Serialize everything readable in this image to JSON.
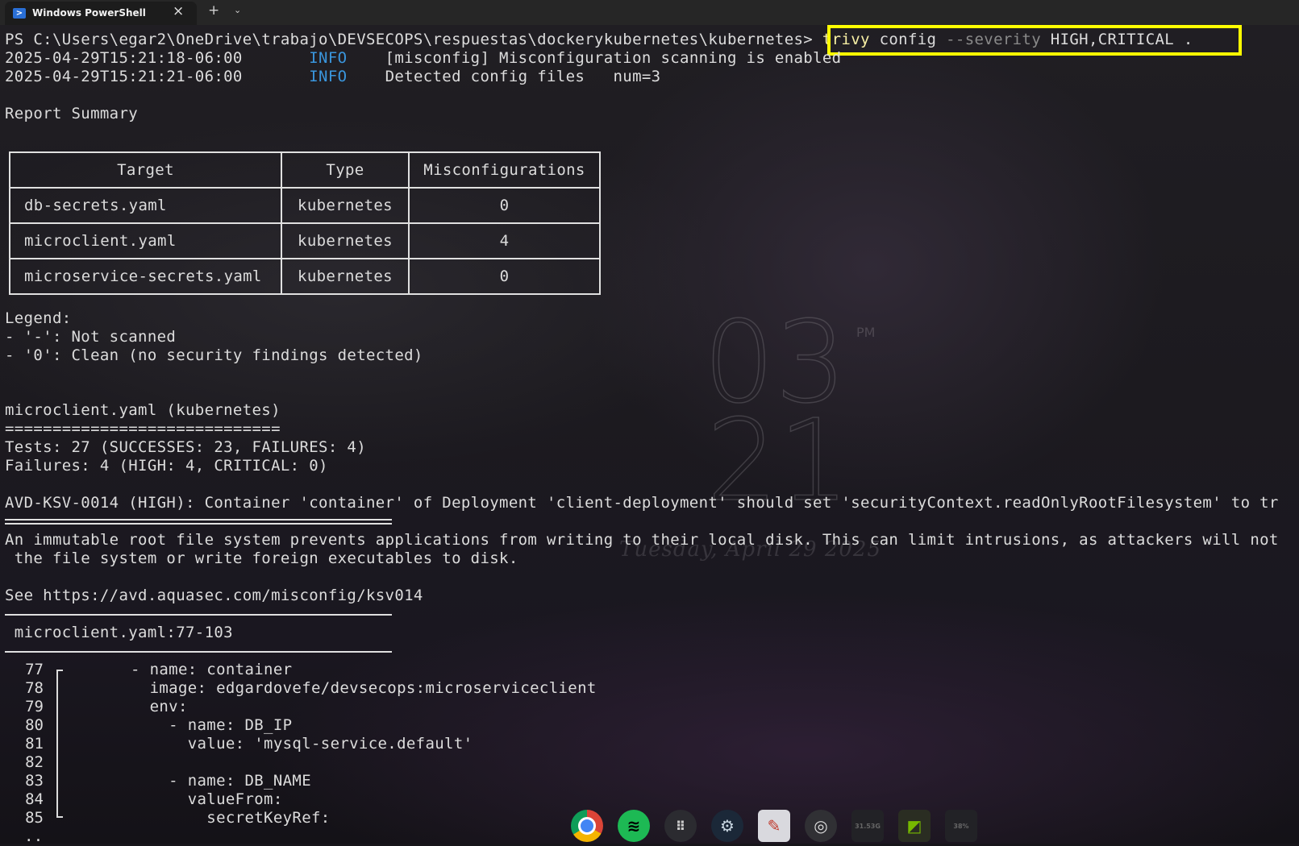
{
  "window": {
    "tab_title": "Windows PowerShell",
    "tab_close": "×",
    "new_tab": "+",
    "dropdown": "⌄"
  },
  "terminal": {
    "prompt": "PS C:\\Users\\egar2\\OneDrive\\trabajo\\DEVSECOPS\\respuestas\\dockerykubernetes\\kubernetes> ",
    "command_name": "trivy",
    "command_sub": " config ",
    "command_flag": "--severity",
    "command_args": " HIGH,CRITICAL .",
    "log1_time": "2025-04-29T15:21:18-06:00",
    "log1_level": "INFO",
    "log1_msg": "[misconfig] Misconfiguration scanning is enabled",
    "log2_time": "2025-04-29T15:21:21-06:00",
    "log2_level": "INFO",
    "log2_msg": "Detected config files   num=3",
    "report_summary": "Report Summary",
    "table": {
      "headers": [
        "Target",
        "Type",
        "Misconfigurations"
      ],
      "rows": [
        [
          "db-secrets.yaml",
          "kubernetes",
          "0"
        ],
        [
          "microclient.yaml",
          "kubernetes",
          "4"
        ],
        [
          "microservice-secrets.yaml",
          "kubernetes",
          "0"
        ]
      ]
    },
    "legend_title": "Legend:",
    "legend_1": "- '-': Not scanned",
    "legend_2": "- '0': Clean (no security findings detected)",
    "section_title": "microclient.yaml (kubernetes)",
    "section_rule": "=============================",
    "tests": "Tests: 27 (SUCCESSES: 23, FAILURES: 4)",
    "failures": "Failures: 4 (HIGH: 4, CRITICAL: 0)",
    "finding": "AVD-KSV-0014 (HIGH): Container 'container' of Deployment 'client-deployment' should set 'securityContext.readOnlyRootFilesystem' to tr",
    "description_1": "An immutable root file system prevents applications from writing to their local disk. This can limit intrusions, as attackers will not",
    "description_2": " the file system or write foreign executables to disk.",
    "see_link": "See https://avd.aquasec.com/misconfig/ksv014",
    "location": " microclient.yaml:77-103",
    "code_lines": [
      {
        "num": "77",
        "text": "- name: container"
      },
      {
        "num": "78",
        "text": "  image: edgardovefe/devsecops:microserviceclient"
      },
      {
        "num": "79",
        "text": "  env:"
      },
      {
        "num": "80",
        "text": "    - name: DB_IP"
      },
      {
        "num": "81",
        "text": "      value: 'mysql-service.default'"
      },
      {
        "num": "82",
        "text": ""
      },
      {
        "num": "83",
        "text": "    - name: DB_NAME"
      },
      {
        "num": "84",
        "text": "      valueFrom:"
      },
      {
        "num": "85",
        "text": "        secretKeyRef:"
      }
    ],
    "ellipsis": ".."
  },
  "wallpaper": {
    "clock_hour": "03",
    "clock_minute": "21",
    "clock_ampm": "PM",
    "clock_date": "Tuesday, April 29 2025"
  },
  "dock": {
    "items": [
      "chrome-icon",
      "spotify-icon",
      "app-grid-icon",
      "steam-icon",
      "paint-icon",
      "obs-icon",
      "cpu-widget-icon",
      "nvidia-icon",
      "gpu-widget-icon"
    ],
    "cpu_label": "31.53G",
    "gpu_label": "38%"
  },
  "colors": {
    "info": "#3a96dd",
    "command": "#f9f1a5",
    "highlight": "#ffff00",
    "background": "#17151a"
  }
}
